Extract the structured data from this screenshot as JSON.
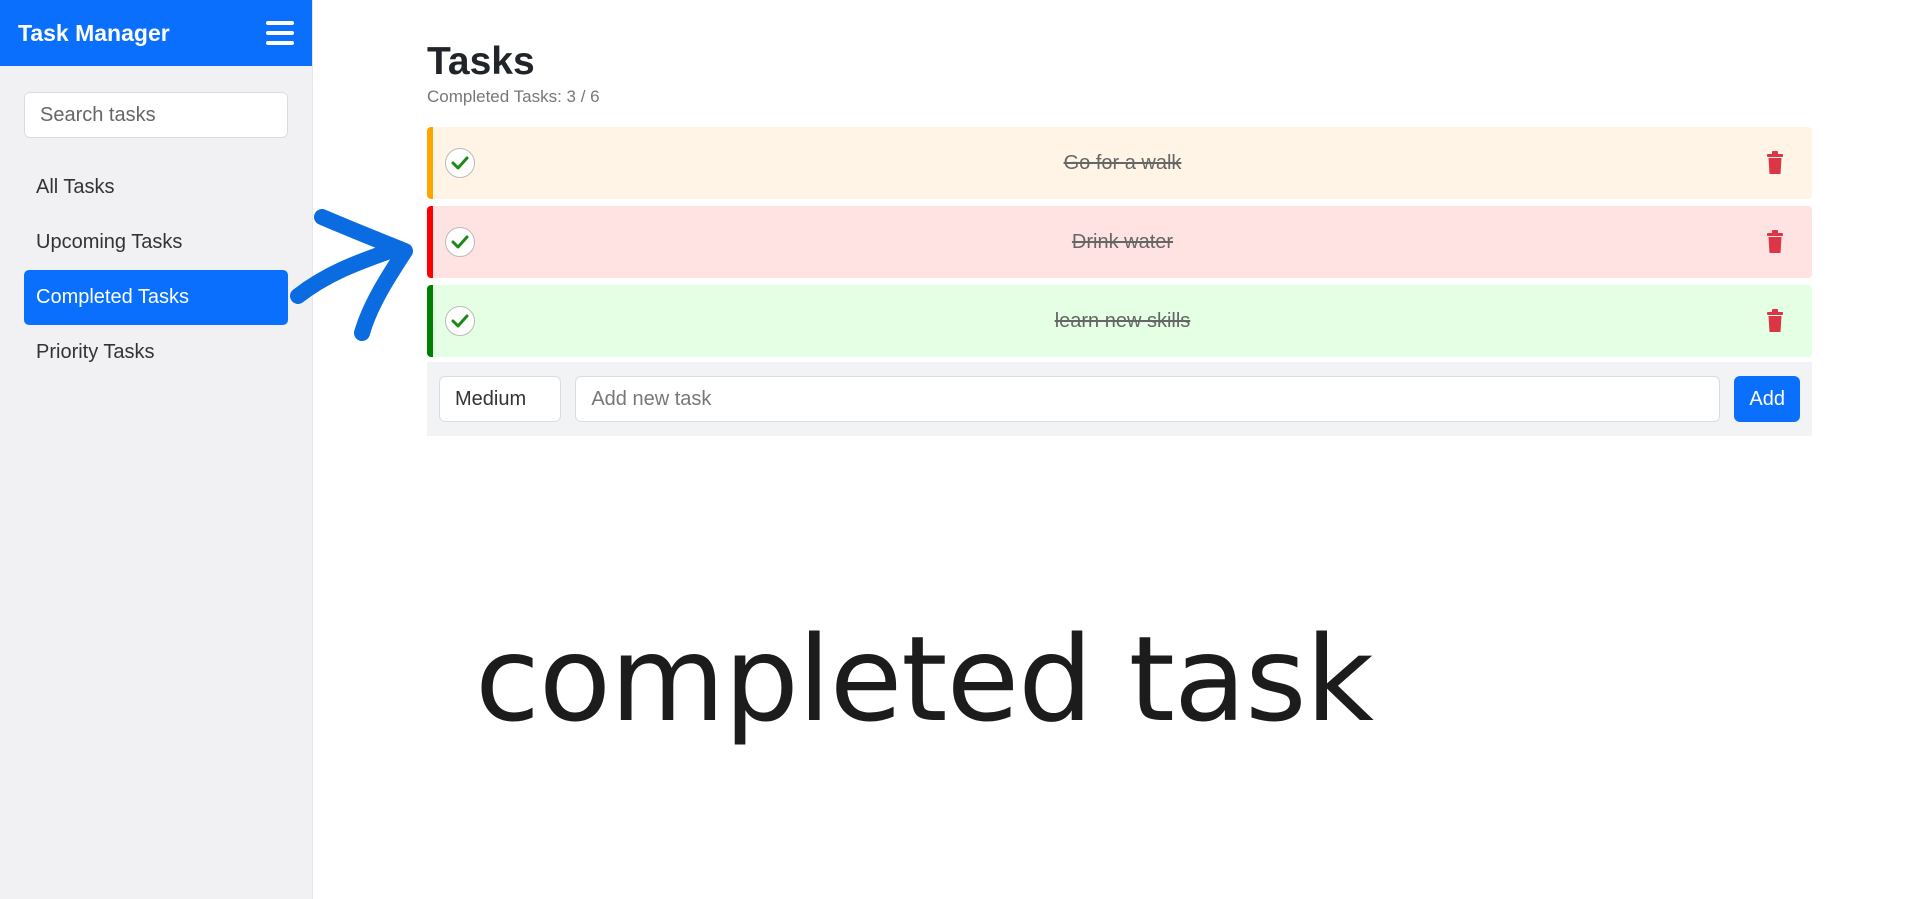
{
  "app": {
    "title": "Task Manager"
  },
  "sidebar": {
    "search_placeholder": "Search tasks",
    "items": [
      {
        "label": "All Tasks",
        "active": false
      },
      {
        "label": "Upcoming Tasks",
        "active": false
      },
      {
        "label": "Completed Tasks",
        "active": true
      },
      {
        "label": "Priority Tasks",
        "active": false
      }
    ]
  },
  "main": {
    "title": "Tasks",
    "counter": "Completed Tasks: 3 / 6",
    "tasks": [
      {
        "text": "Go for a walk",
        "completed": true,
        "priority_color": "#ffa500",
        "bg_color": "#fff4e5"
      },
      {
        "text": "Drink water",
        "completed": true,
        "priority_color": "#ff0000",
        "bg_color": "#ffe2e2"
      },
      {
        "text": "learn new skills",
        "completed": true,
        "priority_color": "#008000",
        "bg_color": "#e4ffe4"
      }
    ],
    "add_form": {
      "priority_value": "Medium",
      "input_placeholder": "Add new task",
      "add_label": "Add"
    }
  },
  "annotation": {
    "caption": "completed task",
    "arrow_color": "#0a6ce0"
  },
  "colors": {
    "accent": "#0a6ffc",
    "check": "#1a8a1a",
    "trash": "#dc3545"
  }
}
